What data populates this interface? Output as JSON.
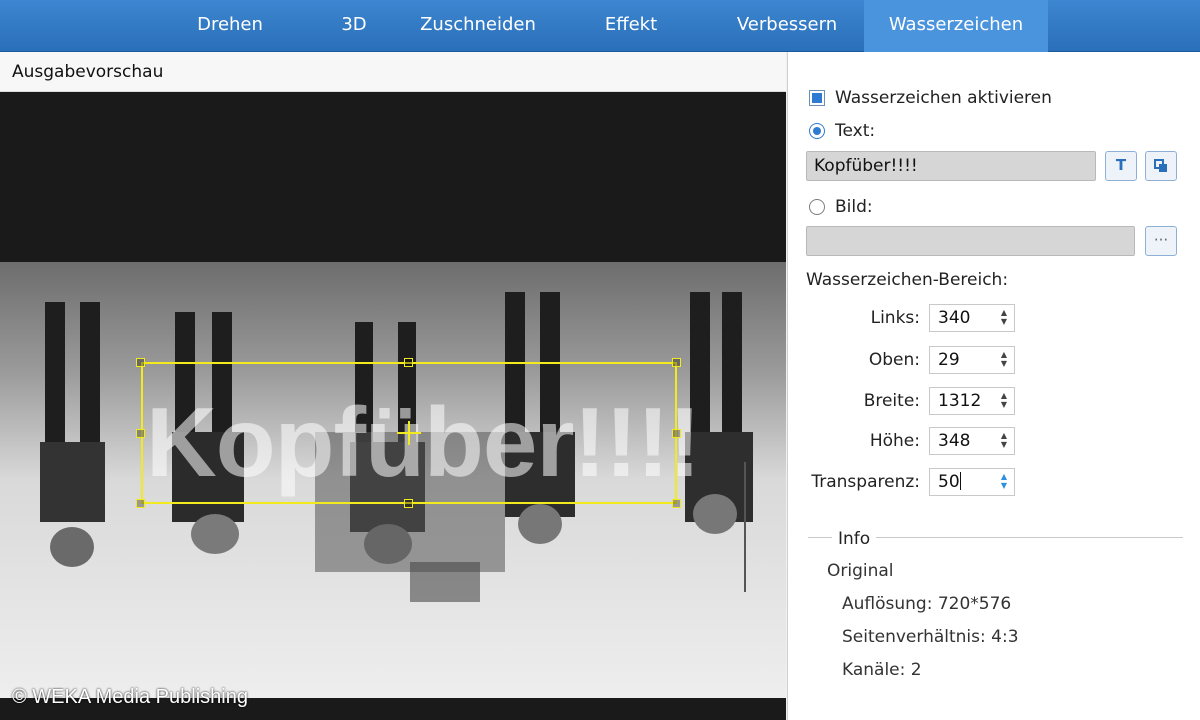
{
  "tabs": [
    {
      "label": "Drehen",
      "active": false
    },
    {
      "label": "3D",
      "active": false
    },
    {
      "label": "Zuschneiden",
      "active": false
    },
    {
      "label": "Effekt",
      "active": false
    },
    {
      "label": "Verbessern",
      "active": false
    },
    {
      "label": "Wasserzeichen",
      "active": true
    }
  ],
  "preview": {
    "title": "Ausgabevorschau",
    "watermark_text": "Kopfüber!!!!",
    "copyright": "© WEKA Media Publishing"
  },
  "watermark": {
    "enable_label": "Wasserzeichen aktivieren",
    "enabled": true,
    "text_label": "Text:",
    "text_selected": true,
    "text_value": "Kopfüber!!!!",
    "image_label": "Bild:",
    "image_value": "",
    "browse_label": "···",
    "area_label": "Wasserzeichen-Bereich:",
    "fields": {
      "left": {
        "label": "Links:",
        "value": "340"
      },
      "top": {
        "label": "Oben:",
        "value": "29"
      },
      "width": {
        "label": "Breite:",
        "value": "1312"
      },
      "height": {
        "label": "Höhe:",
        "value": "348"
      },
      "transparency": {
        "label": "Transparenz:",
        "value": "50"
      }
    }
  },
  "info": {
    "title": "Info",
    "section": "Original",
    "resolution": "Auflösung: 720*576",
    "aspect": "Seitenverhältnis: 4:3",
    "channels": "Kanäle: 2"
  },
  "colors": {
    "tabbar": "#2a6fb9",
    "tab_active": "#4a93dd",
    "selection": "#f2ea1c",
    "accent": "#2e7bd1"
  }
}
